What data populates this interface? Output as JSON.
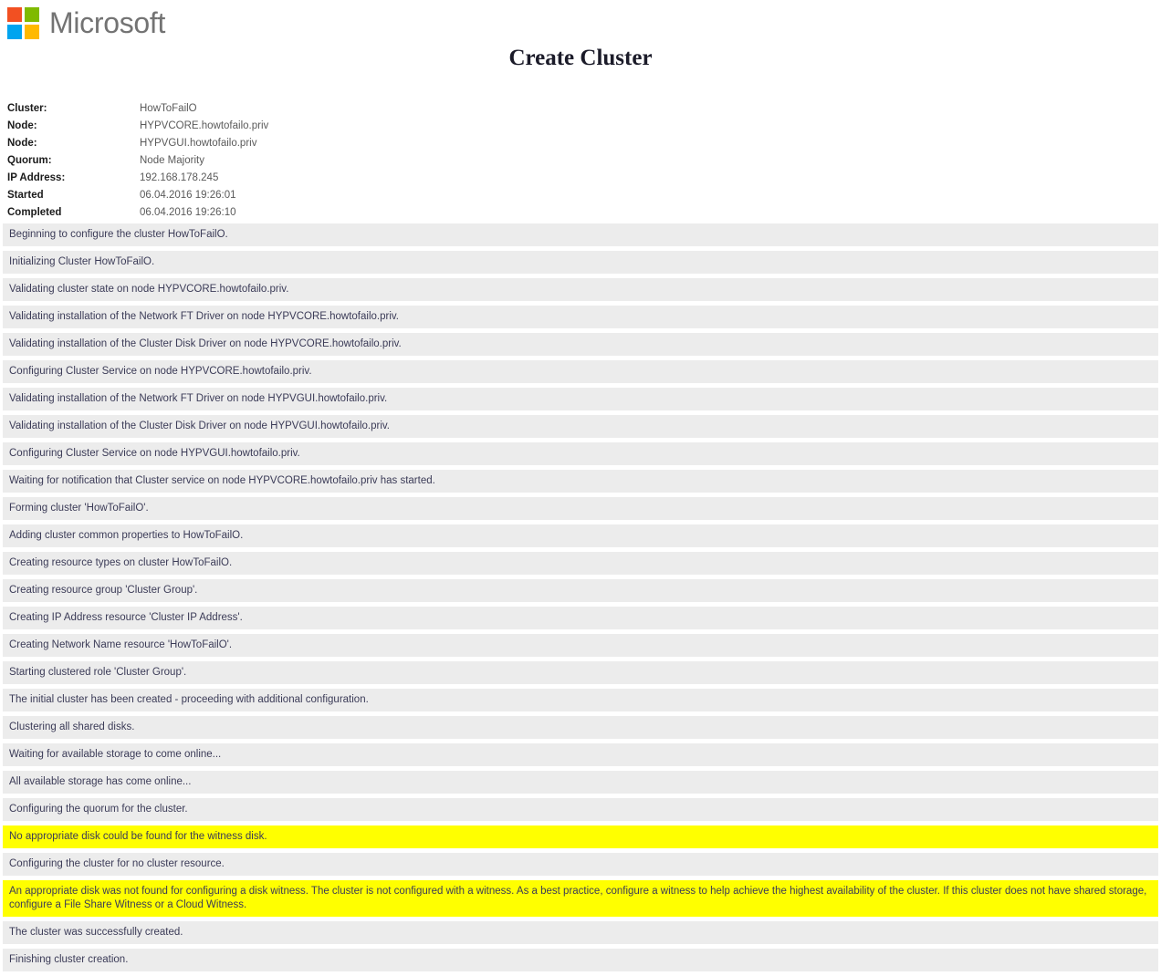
{
  "brand": {
    "name": "Microsoft",
    "logo_squares": [
      {
        "name": "logo-square-red",
        "color": "#f25022"
      },
      {
        "name": "logo-square-green",
        "color": "#7fba00"
      },
      {
        "name": "logo-square-blue",
        "color": "#00a4ef"
      },
      {
        "name": "logo-square-yellow",
        "color": "#ffb900"
      }
    ]
  },
  "page": {
    "title": "Create Cluster"
  },
  "summary": {
    "rows": [
      {
        "label": "Cluster:",
        "value": "HowToFailO"
      },
      {
        "label": "Node:",
        "value": "HYPVCORE.howtofailo.priv"
      },
      {
        "label": "Node:",
        "value": "HYPVGUI.howtofailo.priv"
      },
      {
        "label": "Quorum:",
        "value": "Node Majority"
      },
      {
        "label": "IP Address:",
        "value": "192.168.178.245"
      },
      {
        "label": "Started",
        "value": "06.04.2016 19:26:01"
      },
      {
        "label": "Completed",
        "value": "06.04.2016 19:26:10"
      }
    ]
  },
  "log": {
    "entries": [
      {
        "text": "Beginning to configure the cluster HowToFailO.",
        "warning": false
      },
      {
        "text": "Initializing Cluster HowToFailO.",
        "warning": false
      },
      {
        "text": "Validating cluster state on node HYPVCORE.howtofailo.priv.",
        "warning": false
      },
      {
        "text": "Validating installation of the Network FT Driver on node HYPVCORE.howtofailo.priv.",
        "warning": false
      },
      {
        "text": "Validating installation of the Cluster Disk Driver on node HYPVCORE.howtofailo.priv.",
        "warning": false
      },
      {
        "text": "Configuring Cluster Service on node HYPVCORE.howtofailo.priv.",
        "warning": false
      },
      {
        "text": "Validating installation of the Network FT Driver on node HYPVGUI.howtofailo.priv.",
        "warning": false
      },
      {
        "text": "Validating installation of the Cluster Disk Driver on node HYPVGUI.howtofailo.priv.",
        "warning": false
      },
      {
        "text": "Configuring Cluster Service on node HYPVGUI.howtofailo.priv.",
        "warning": false
      },
      {
        "text": "Waiting for notification that Cluster service on node HYPVCORE.howtofailo.priv has started.",
        "warning": false
      },
      {
        "text": "Forming cluster 'HowToFailO'.",
        "warning": false
      },
      {
        "text": "Adding cluster common properties to HowToFailO.",
        "warning": false
      },
      {
        "text": "Creating resource types on cluster HowToFailO.",
        "warning": false
      },
      {
        "text": "Creating resource group 'Cluster Group'.",
        "warning": false
      },
      {
        "text": "Creating IP Address resource 'Cluster IP Address'.",
        "warning": false
      },
      {
        "text": "Creating Network Name resource 'HowToFailO'.",
        "warning": false
      },
      {
        "text": "Starting clustered role 'Cluster Group'.",
        "warning": false
      },
      {
        "text": "The initial cluster has been created - proceeding with additional configuration.",
        "warning": false
      },
      {
        "text": "Clustering all shared disks.",
        "warning": false
      },
      {
        "text": "Waiting for available storage to come online...",
        "warning": false
      },
      {
        "text": "All available storage has come online...",
        "warning": false
      },
      {
        "text": "Configuring the quorum for the cluster.",
        "warning": false
      },
      {
        "text": "No appropriate disk could be found for the witness disk.",
        "warning": true
      },
      {
        "text": "Configuring the cluster for no cluster resource.",
        "warning": false
      },
      {
        "text": "An appropriate disk was not found for configuring a disk witness. The cluster is not configured with a witness. As a best practice, configure a witness to help achieve the highest availability of the cluster. If this cluster does not have shared storage, configure a File Share Witness or a Cloud Witness.",
        "warning": true
      },
      {
        "text": "The cluster was successfully created.",
        "warning": false
      },
      {
        "text": "Finishing cluster creation.",
        "warning": false
      }
    ]
  },
  "colors": {
    "row_background": "#ececec",
    "warning_background": "#ffff00",
    "log_text": "#3b3b57",
    "label_text": "#1b1b1b",
    "value_text": "#5a5a5a"
  }
}
